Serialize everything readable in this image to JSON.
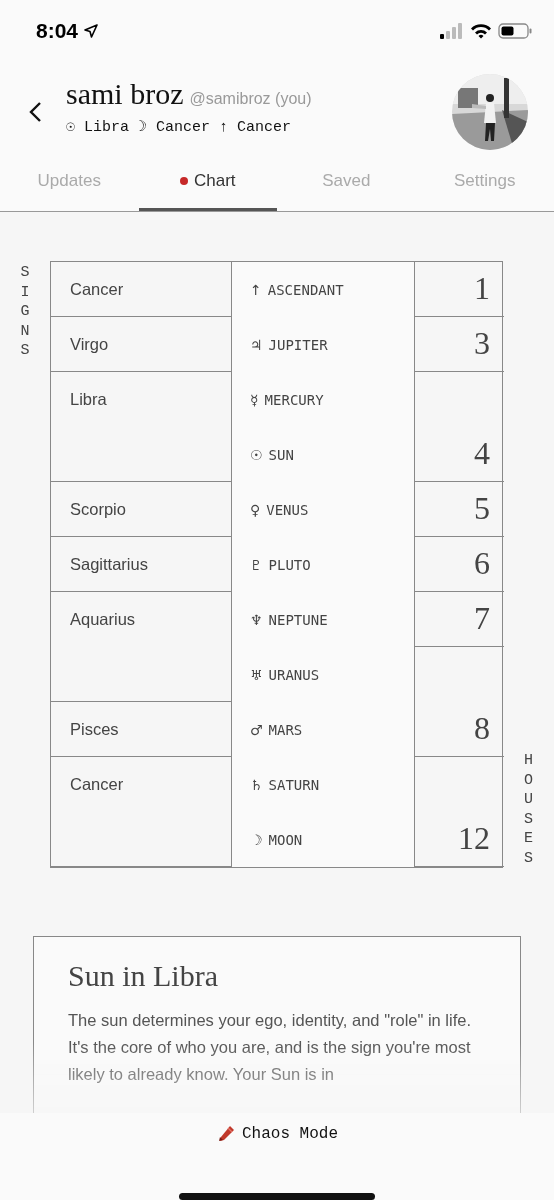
{
  "status_bar": {
    "time": "8:04"
  },
  "profile": {
    "name": "sami broz",
    "handle": "@samibroz (you)",
    "signs": "☉ Libra ☽ Cancer ↑ Cancer"
  },
  "tabs": [
    {
      "label": "Updates",
      "selected": false
    },
    {
      "label": "Chart",
      "selected": true
    },
    {
      "label": "Saved",
      "selected": false
    },
    {
      "label": "Settings",
      "selected": false
    }
  ],
  "chart": {
    "signs_label": "SIGNS",
    "houses_label": "HOUSES",
    "planets": [
      {
        "glyph": "↑",
        "name": "ASCENDANT",
        "sign": "Cancer",
        "house": "1"
      },
      {
        "glyph": "♃",
        "name": "JUPITER",
        "sign": "Virgo",
        "house": "3"
      },
      {
        "glyph": "☿",
        "name": "MERCURY",
        "sign": "Libra",
        "house": "4"
      },
      {
        "glyph": "☉",
        "name": "SUN"
      },
      {
        "glyph": "♀",
        "name": "VENUS",
        "sign": "Scorpio",
        "house": "5"
      },
      {
        "glyph": "♇",
        "name": "PLUTO",
        "sign": "Sagittarius",
        "house": "6"
      },
      {
        "glyph": "♆",
        "name": "NEPTUNE",
        "sign": "Aquarius",
        "house": "7"
      },
      {
        "glyph": "♅",
        "name": "URANUS",
        "house": "8"
      },
      {
        "glyph": "♂",
        "name": "MARS",
        "sign": "Pisces"
      },
      {
        "glyph": "♄",
        "name": "SATURN",
        "sign": "Cancer",
        "house": "12"
      },
      {
        "glyph": "☽",
        "name": "MOON"
      }
    ]
  },
  "card": {
    "title": "Sun in Libra",
    "body": "The sun determines your ego, identity, and \"role\" in life. It's the core of who you are, and is the sign you're most likely to already know. Your Sun is in"
  },
  "footer": {
    "label": "Chaos Mode"
  }
}
